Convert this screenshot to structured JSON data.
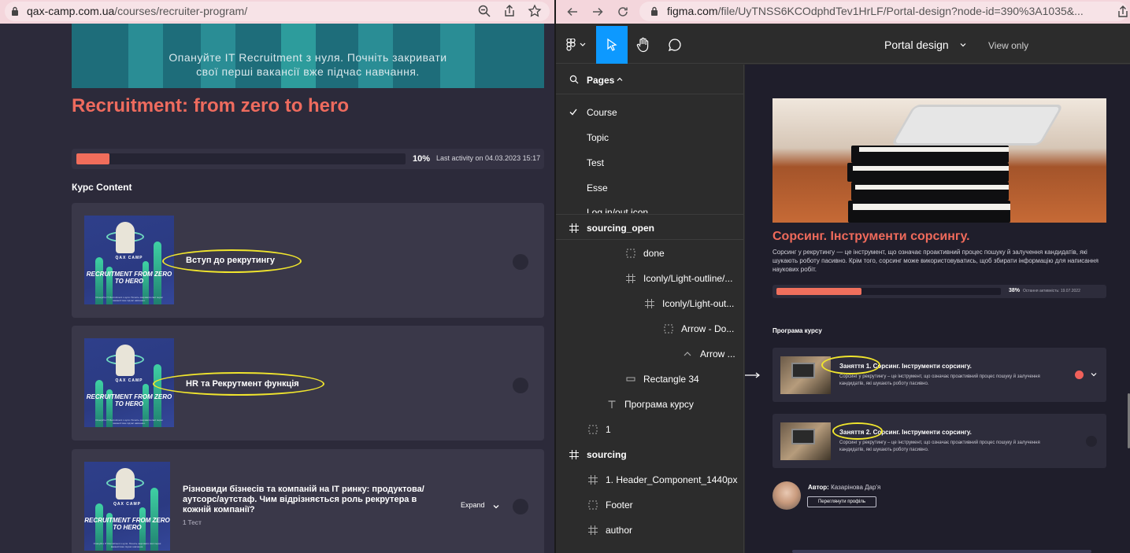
{
  "left_browser": {
    "url_host": "qax-camp.com.ua",
    "url_path": "/courses/recruiter-program/",
    "banner_text_line1": "Опануйте IT Recruitment з нуля. Почніть закривати",
    "banner_text_line2": "свої перші вакансії вже підчас навчання.",
    "course_title": "Recruitment: from zero to hero",
    "progress": {
      "percent": 10,
      "percent_label": "10%",
      "last_activity": "Last activity on 04.03.2023 15:17"
    },
    "content_heading": "Курс Content",
    "thumb_brand": "QAX CAMP",
    "thumb_title": "RECRUITMENT FROM ZERO TO HERO",
    "thumb_subtitle": "Опануйте IT Recruitment з нуля. Почніть закривати свої перші вакансії вже підчас навчання.",
    "lessons": [
      {
        "title": "Вступ до рекрутингу"
      },
      {
        "title": "HR та Рекрутмент функція"
      },
      {
        "title": "Різновиди бізнесів та компаній на IT ринку: продуктова/ аутсорс/аутстаф. Чим відрізняється роль рекрутера в кожній компанії?",
        "sub": "1 Тест",
        "expand": "Expand"
      }
    ]
  },
  "right_browser": {
    "url_host": "figma.com",
    "url_path": "/file/UyTNSS6KCOdphdTev1HrLF/Portal-design?node-id=390%3A1035&...",
    "file_name": "Portal design",
    "view_mode": "View only",
    "pages_label": "Pages",
    "pages": [
      "Course",
      "Topic",
      "Test",
      "Esse",
      "Log in/out icon"
    ],
    "layers": [
      {
        "label": "sourcing_open",
        "icon": "frame-icon"
      },
      {
        "label": "done",
        "icon": "group-icon"
      },
      {
        "label": "Iconly/Light-outline/...",
        "icon": "frame-icon"
      },
      {
        "label": "Iconly/Light-out...",
        "icon": "frame-icon"
      },
      {
        "label": "Arrow - Do...",
        "icon": "group-icon"
      },
      {
        "label": "Arrow ...",
        "icon": "vector-icon"
      },
      {
        "label": "Rectangle 34",
        "icon": "rectangle-icon"
      },
      {
        "label": "Програма курсу",
        "icon": "text-icon"
      },
      {
        "label": "1",
        "icon": "group-icon"
      },
      {
        "label": "sourcing",
        "icon": "frame-icon"
      },
      {
        "label": "1. Header_Component_1440px",
        "icon": "frame-icon"
      },
      {
        "label": "Footer",
        "icon": "group-icon"
      },
      {
        "label": "author",
        "icon": "frame-icon"
      }
    ],
    "design": {
      "title": "Сорсинг. Інструменти сорсингу.",
      "description": "Сорсинг у рекрутингу — це інструмент, що означає проактивний процес пошуку й залучення кандидатів, які шукають роботу пасивно. Крім того, сорсинг може використовуватись, щоб збирати інформацію для написання наукових робіт.",
      "progress": {
        "percent": 38,
        "percent_label": "38%",
        "last_activity": "Остання активність: 19.07.2022"
      },
      "program_heading": "Програма курсу",
      "lessons": [
        {
          "title": "Заняття 1. Сорсинг. Інструменти сорсингу.",
          "desc": "Сорсинг у рекрутингу – це інструмент, що означає проактивний процес пошуку й залучення кандидатів, які шукають роботу пасивно.",
          "status_color": "#f0605a"
        },
        {
          "title": "Заняття 2. Сорсинг. Інструменти сорсингу.",
          "desc": "Сорсинг у рекрутингу – це інструмент, що означає проактивний процес пошуку й залучення кандидатів, які шукають роботу пасивно.",
          "status_color": "#24232f"
        }
      ],
      "author_label": "Автор:",
      "author_name": "Казарінова Дар'я",
      "profile_button": "Переглянути профіль"
    }
  },
  "colors": {
    "accent": "#ee6b5e",
    "figma_blue": "#0d99ff",
    "highlight_oval": "#f0e52d"
  }
}
